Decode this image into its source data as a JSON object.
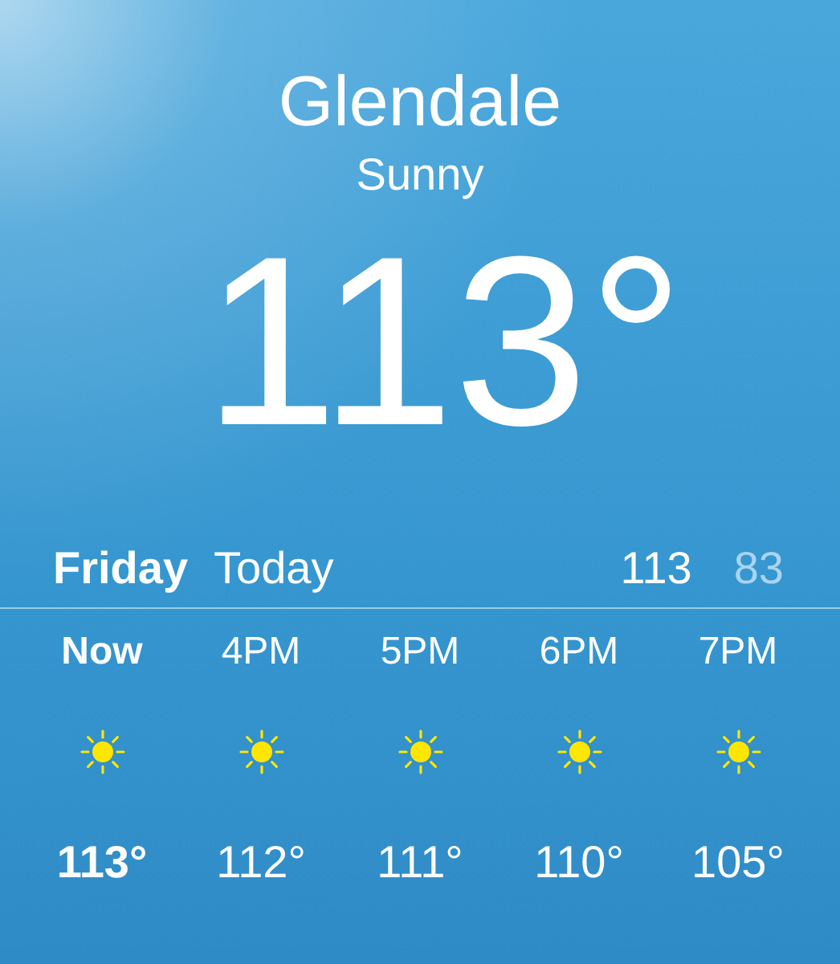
{
  "location": {
    "city": "Glendale",
    "condition": "Sunny",
    "temperature": "113°"
  },
  "day": {
    "name": "Friday",
    "label": "Today",
    "high": "113",
    "low": "83"
  },
  "hours": [
    {
      "time": "Now",
      "temp": "113°",
      "selected": true
    },
    {
      "time": "4PM",
      "temp": "112°",
      "selected": false
    },
    {
      "time": "5PM",
      "temp": "111°",
      "selected": false
    },
    {
      "time": "6PM",
      "temp": "110°",
      "selected": false
    },
    {
      "time": "7PM",
      "temp": "105°",
      "selected": false
    }
  ]
}
